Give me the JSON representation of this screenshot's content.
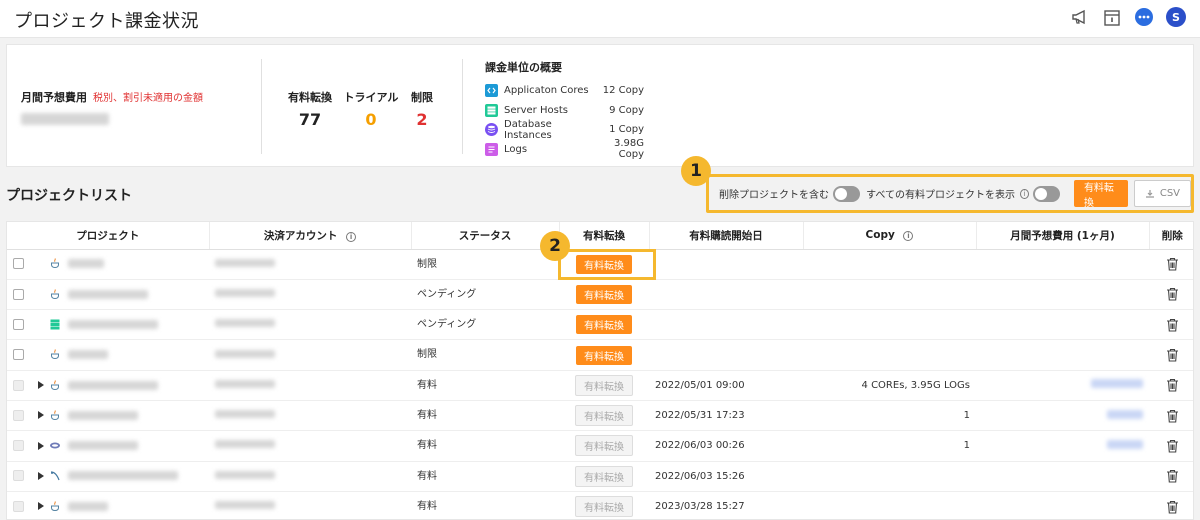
{
  "page": {
    "title": "プロジェクト課金状況"
  },
  "header_icons": [
    "megaphone-icon",
    "calendar-icon",
    "chat-icon"
  ],
  "user": {
    "avatar_initial": "S"
  },
  "summary": {
    "monthly_label": "月間予想費用",
    "monthly_note": "税別、割引未適用の金額",
    "stats": [
      {
        "label": "有料転換",
        "value": "77",
        "color": "#222222"
      },
      {
        "label": "トライアル",
        "value": "0",
        "color": "#f59f00"
      },
      {
        "label": "制限",
        "value": "2",
        "color": "#e03131"
      }
    ],
    "billing_title": "課金単位の概要",
    "billing_units": [
      {
        "name": "Applicaton Cores",
        "value": "12 Copy",
        "icon": "code-icon",
        "color": "#1c9ad6"
      },
      {
        "name": "Server Hosts",
        "value": "9 Copy",
        "icon": "server-icon",
        "color": "#20c997"
      },
      {
        "name": "Database Instances",
        "value": "1 Copy",
        "icon": "database-icon",
        "color": "#7950f2"
      },
      {
        "name": "Logs",
        "value": "3.98G Copy",
        "icon": "log-icon",
        "color": "#cc5de8"
      }
    ]
  },
  "list": {
    "title": "プロジェクトリスト",
    "toolbar": {
      "include_deleted_label": "削除プロジェクトを含む",
      "show_paid_label": "すべての有料プロジェクトを表示",
      "convert_button": "有料転換",
      "csv_button": "CSV"
    },
    "columns": [
      "プロジェクト",
      "決済アカウント",
      "ステータス",
      "有料転換",
      "有料購読開始日",
      "Copy",
      "月間予想費用 (1ヶ月)",
      "削除"
    ],
    "rows": [
      {
        "status": "制限",
        "convert": "有料転換",
        "convert_enabled": true,
        "start": "",
        "copy": "",
        "has_cost": false,
        "expandable": false,
        "icon": "java-icon"
      },
      {
        "status": "ペンディング",
        "convert": "有料転換",
        "convert_enabled": true,
        "start": "",
        "copy": "",
        "has_cost": false,
        "expandable": false,
        "icon": "java-icon"
      },
      {
        "status": "ペンディング",
        "convert": "有料転換",
        "convert_enabled": true,
        "start": "",
        "copy": "",
        "has_cost": false,
        "expandable": false,
        "icon": "server-icon"
      },
      {
        "status": "制限",
        "convert": "有料転換",
        "convert_enabled": true,
        "start": "",
        "copy": "",
        "has_cost": false,
        "expandable": false,
        "icon": "java-icon"
      },
      {
        "status": "有料",
        "convert": "有料転換",
        "convert_enabled": false,
        "start": "2022/05/01 09:00",
        "copy": "4 COREs, 3.95G LOGs",
        "has_cost": true,
        "expandable": true,
        "icon": "java-icon"
      },
      {
        "status": "有料",
        "convert": "有料転換",
        "convert_enabled": false,
        "start": "2022/05/31 17:23",
        "copy": "1",
        "has_cost": true,
        "expandable": true,
        "icon": "java-icon"
      },
      {
        "status": "有料",
        "convert": "有料転換",
        "convert_enabled": false,
        "start": "2022/06/03 00:26",
        "copy": "1",
        "has_cost": true,
        "expandable": true,
        "icon": "php-icon"
      },
      {
        "status": "有料",
        "convert": "有料転換",
        "convert_enabled": false,
        "start": "2022/06/03 15:26",
        "copy": "",
        "has_cost": false,
        "expandable": true,
        "icon": "mysql-icon"
      },
      {
        "status": "有料",
        "convert": "有料転換",
        "convert_enabled": false,
        "start": "2023/03/28 15:27",
        "copy": "",
        "has_cost": false,
        "expandable": true,
        "icon": "java-icon"
      }
    ]
  },
  "markers": [
    "1",
    "2"
  ],
  "colors": {
    "accent": "#ff8c1a",
    "highlight": "#f5b82e",
    "avatar": "#2b4fc9"
  }
}
